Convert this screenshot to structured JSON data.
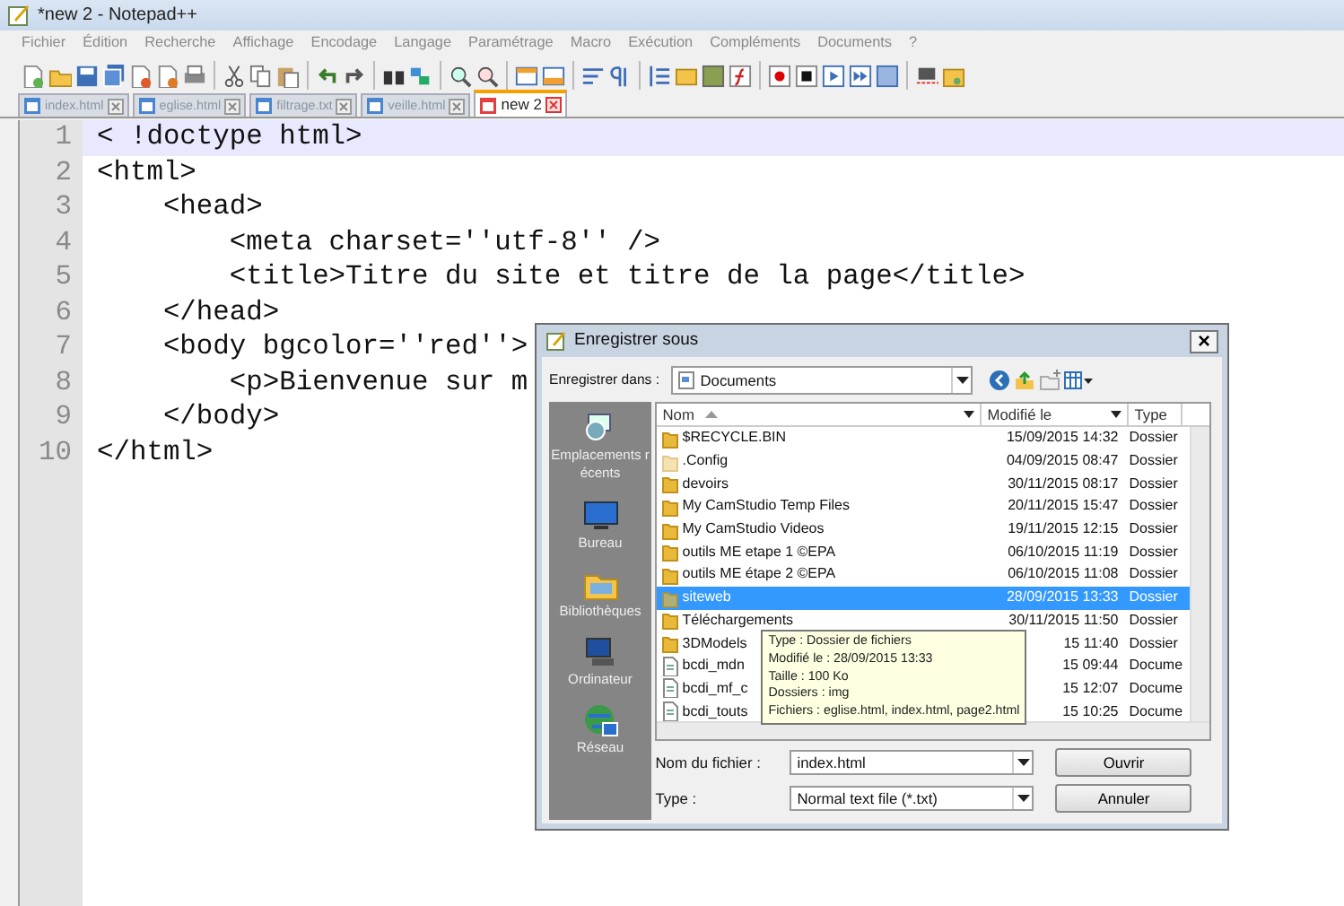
{
  "window": {
    "title": "*new 2 - Notepad++"
  },
  "menu": [
    "Fichier",
    "Édition",
    "Recherche",
    "Affichage",
    "Encodage",
    "Langage",
    "Paramétrage",
    "Macro",
    "Exécution",
    "Compléments",
    "Documents",
    "?"
  ],
  "tabs": [
    {
      "label": "index.html",
      "selected": false
    },
    {
      "label": "eglise.html",
      "selected": false
    },
    {
      "label": "filtrage.txt",
      "selected": false
    },
    {
      "label": "veille.html",
      "selected": false
    },
    {
      "label": "new  2",
      "selected": true
    }
  ],
  "editor": {
    "lines": [
      {
        "number": "1",
        "text": "< !doctype html>",
        "selected": true
      },
      {
        "number": "2",
        "text": "<html>",
        "selected": false
      },
      {
        "number": "3",
        "text": "    <head>",
        "selected": false
      },
      {
        "number": "4",
        "text": "        <meta charset=''utf-8'' />",
        "selected": false
      },
      {
        "number": "5",
        "text": "        <title>Titre du site et titre de la page</title>",
        "selected": false
      },
      {
        "number": "6",
        "text": "    </head>",
        "selected": false
      },
      {
        "number": "7",
        "text": "    <body bgcolor=''red''>",
        "selected": false
      },
      {
        "number": "8",
        "text": "        <p>Bienvenue sur m",
        "selected": false
      },
      {
        "number": "9",
        "text": "    </body>",
        "selected": false
      },
      {
        "number": "10",
        "text": "</html>",
        "selected": false
      }
    ]
  },
  "dialog": {
    "title": "Enregistrer sous",
    "close": "×",
    "location": {
      "label": "Enregistrer dans :",
      "value": "Documents"
    },
    "places": [
      "Emplacements récents",
      "Bureau",
      "Bibliothèques",
      "Ordinateur",
      "Réseau"
    ],
    "columns": [
      "Nom",
      "Modifié le",
      "Type"
    ],
    "files": [
      {
        "name": "$RECYCLE.BIN",
        "date": "15/09/2015 14:32",
        "type": "Dossier",
        "kind": "folder",
        "selected": false
      },
      {
        "name": ".Config",
        "date": "04/09/2015 08:47",
        "type": "Dossier",
        "kind": "hidden-folder",
        "selected": false
      },
      {
        "name": "devoirs",
        "date": "30/11/2015 08:17",
        "type": "Dossier",
        "kind": "folder",
        "selected": false
      },
      {
        "name": "My CamStudio Temp Files",
        "date": "20/11/2015 15:47",
        "type": "Dossier",
        "kind": "folder",
        "selected": false
      },
      {
        "name": "My CamStudio Videos",
        "date": "19/11/2015 12:15",
        "type": "Dossier",
        "kind": "folder",
        "selected": false
      },
      {
        "name": "outils ME etape 1 ©EPA",
        "date": "06/10/2015 11:19",
        "type": "Dossier",
        "kind": "folder",
        "selected": false
      },
      {
        "name": "outils ME étape 2 ©EPA",
        "date": "06/10/2015 11:08",
        "type": "Dossier",
        "kind": "folder",
        "selected": false
      },
      {
        "name": "siteweb",
        "date": "28/09/2015 13:33",
        "type": "Dossier",
        "kind": "folder",
        "selected": true
      },
      {
        "name": "Téléchargements",
        "date": "30/11/2015 11:50",
        "type": "Dossier",
        "kind": "folder",
        "selected": false
      },
      {
        "name": "3DModels",
        "date": "15 11:40",
        "type": "Dossier",
        "kind": "folder",
        "selected": false
      },
      {
        "name": "bcdi_mdn",
        "date": "15 09:44",
        "type": "Docume",
        "kind": "document",
        "selected": false
      },
      {
        "name": "bcdi_mf_c",
        "date": "15 12:07",
        "type": "Docume",
        "kind": "document",
        "selected": false
      },
      {
        "name": "bcdi_touts",
        "date": "15 10:25",
        "type": "Docume",
        "kind": "document",
        "selected": false
      }
    ],
    "tooltip": [
      "Type : Dossier de fichiers",
      "Modifié le : 28/09/2015 13:33",
      "Taille : 100 Ko",
      "Dossiers : img",
      "Fichiers : eglise.html, index.html, page2.html"
    ],
    "filename": {
      "label": "Nom du fichier :",
      "value": "index.html"
    },
    "filetype": {
      "label": "Type :",
      "value": "Normal text file (*.txt)"
    },
    "buttons": [
      "Ouvrir",
      "Annuler"
    ]
  }
}
